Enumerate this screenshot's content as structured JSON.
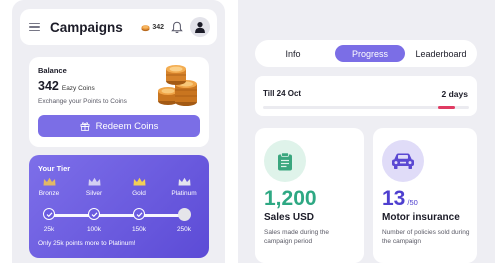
{
  "phone": {
    "header": {
      "title": "Campaigns",
      "coin_count": "342",
      "menu_icon": "hamburger-menu-icon",
      "coin_icon": "coin-icon",
      "bell_icon": "bell-icon",
      "avatar_icon": "user-avatar-icon"
    },
    "balance": {
      "label": "Balance",
      "amount": "342",
      "unit": "Eazy Coins",
      "subtitle": "Exchange your Points to Coins",
      "redeem_label": "Redeem Coins",
      "coins_image": "coin-stack-icon",
      "redeem_icon": "gift-icon"
    },
    "tier": {
      "title": "Your Tier",
      "levels": [
        {
          "name": "Bronze",
          "points": "25k",
          "reached": true
        },
        {
          "name": "Silver",
          "points": "100k",
          "reached": true
        },
        {
          "name": "Gold",
          "points": "150k",
          "reached": true
        },
        {
          "name": "Platinum",
          "points": "250k",
          "reached": false
        }
      ],
      "note": "Only 25k points more to Platinum!",
      "crown_icon": "crown-icon",
      "check_icon": "check-icon"
    }
  },
  "right": {
    "tabs": [
      {
        "label": "Info",
        "active": false
      },
      {
        "label": "Progress",
        "active": true
      },
      {
        "label": "Leaderboard",
        "active": false
      }
    ],
    "deadline": {
      "label": "Till 24 Oct",
      "remaining": "2 days",
      "elapsed_fraction": 0.93
    },
    "stats": [
      {
        "value": "1,200",
        "denominator": "",
        "label": "Sales USD",
        "description": "Sales made during the campaign period",
        "icon": "clipboard-icon"
      },
      {
        "value": "13",
        "denominator": "/50",
        "label": "Motor insurance",
        "description": "Number of policies sold during the campaign",
        "icon": "car-icon"
      }
    ]
  },
  "colors": {
    "accent": "#7b6ee6",
    "tier_gradient_start": "#7d6fe9",
    "tier_gradient_end": "#5c4bd6",
    "sales_green": "#2ea883",
    "motor_purple": "#4e3fcf",
    "deadline_red": "#e03b62",
    "background": "#eeeef3"
  }
}
